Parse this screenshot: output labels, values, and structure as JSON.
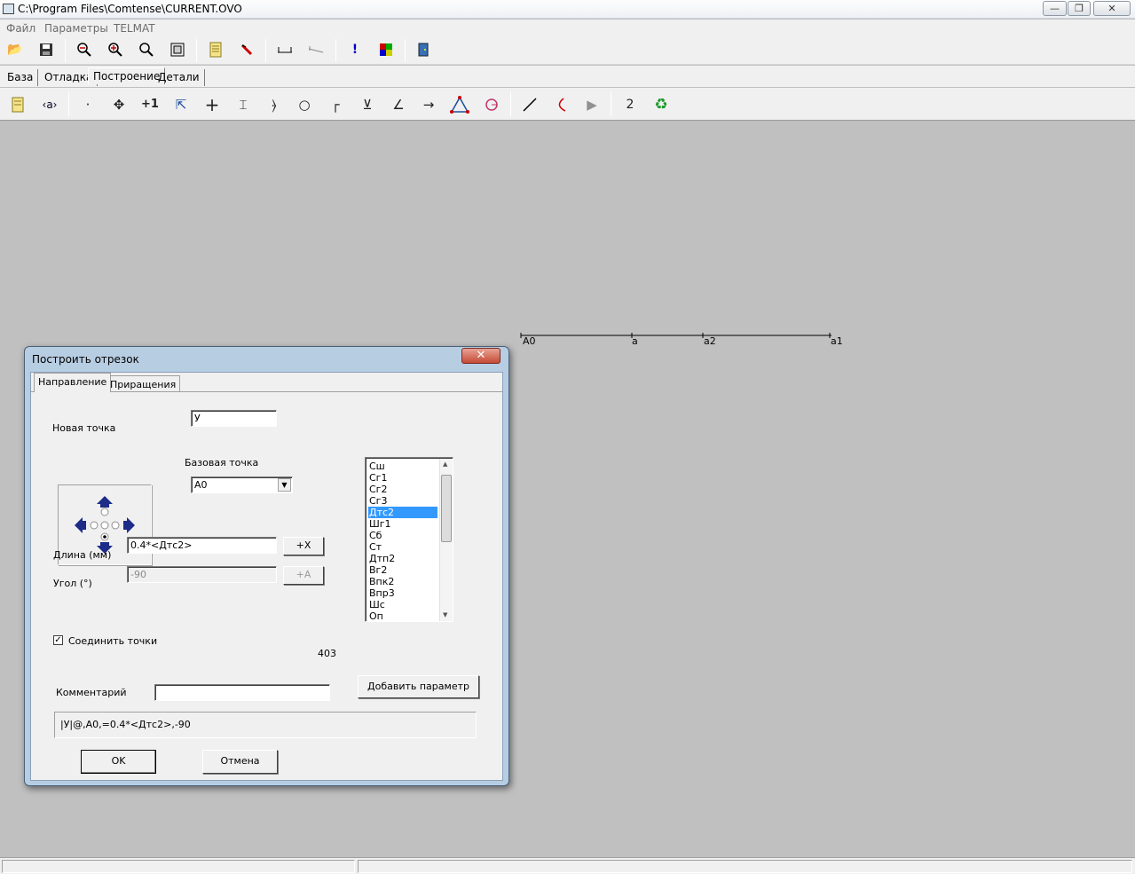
{
  "window": {
    "title": "C:\\Program Files\\Comtense\\CURRENT.OVO"
  },
  "menu": {
    "items": [
      "Файл",
      "Параметры",
      "TELMAT"
    ]
  },
  "tabs": [
    "База",
    "Отладка",
    "Построение",
    "Детали"
  ],
  "toolbar2": {
    "number_label": "2"
  },
  "drawing": {
    "points": [
      "A0",
      "a",
      "a2",
      "a1"
    ]
  },
  "dialog": {
    "title": "Построить отрезок",
    "close_label": "✕",
    "tabs": [
      "Направление",
      "Приращения"
    ],
    "new_point_label": "Новая точка",
    "new_point_value": "У",
    "base_point_label": "Базовая точка",
    "base_point_value": "A0",
    "length_label": "Длина (мм)",
    "length_value": "0.4*<Дтс2>",
    "length_button": "+X",
    "angle_label": "Угол (°)",
    "angle_value": "-90",
    "angle_button": "+A",
    "connect_label": "Соединить точки",
    "connect_checked": true,
    "number_value": "403",
    "comment_label": "Комментарий",
    "comment_value": "",
    "add_param_button": "Добавить параметр",
    "formula": "|У|@,A0,=0.4*<Дтс2>,-90",
    "ok_button": "OK",
    "cancel_button": "Отмена",
    "params_list": [
      "Сш",
      "Сг1",
      "Сг2",
      "Сг3",
      "Дтс2",
      "Шг1",
      "Сб",
      "Ст",
      "Дтп2",
      "Вг2",
      "Впк2",
      "Впр3",
      "Шс",
      "Оп"
    ],
    "params_selected": "Дтс2"
  }
}
